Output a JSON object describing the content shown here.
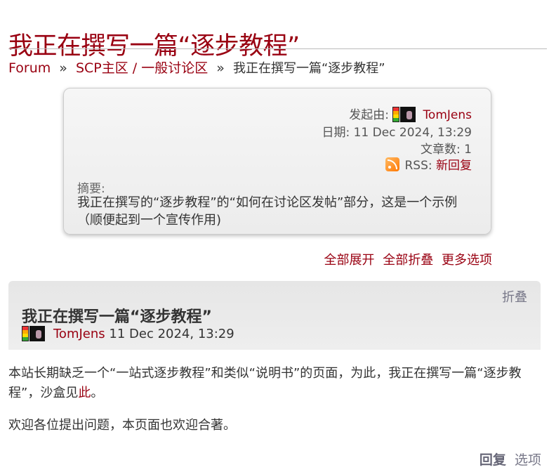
{
  "page": {
    "title": "我正在撰写一篇“逐步教程”"
  },
  "breadcrumb": {
    "forum": "Forum",
    "sep1": "»",
    "category": "SCP主区 / 一般讨论区",
    "sep2": "»",
    "current": "我正在撰写一篇“逐步教程”"
  },
  "summary": {
    "started_by_label": "发起由:",
    "author": "TomJens",
    "date_label": "日期:",
    "date": "11 Dec 2024, 13:29",
    "posts_label": "文章数:",
    "posts": "1",
    "rss_label": "RSS:",
    "rss_link": "新回复",
    "abstract_label": "摘要:",
    "abstract_text": "我正在撰写的“逐步教程”的“如何在讨论区发帖”部分，这是一个示例（顺便起到一个宣传作用)"
  },
  "options": {
    "expand_all": "全部展开",
    "collapse_all": "全部折叠",
    "more": "更多选项"
  },
  "post": {
    "fold": "折叠",
    "title": "我正在撰写一篇“逐步教程”",
    "author": "TomJens",
    "date": "11 Dec 2024, 13:29",
    "body_p1_before": "本站长期缺乏一个“一站式逐步教程”和类似“说明书”的页面，为此，我正在撰写一篇“逐步教程”，沙盒见",
    "body_p1_link": "此",
    "body_p1_after": "。",
    "body_p2": "欢迎各位提出问题，本页面也欢迎合著。",
    "reply": "回复",
    "options": "选项"
  },
  "colors": {
    "accent": "#990011",
    "box_bg": "#f0f0f0",
    "muted_link": "#777788"
  },
  "icons": {
    "rss": "rss-icon",
    "karma": "karma-icon",
    "avatar": "avatar"
  }
}
